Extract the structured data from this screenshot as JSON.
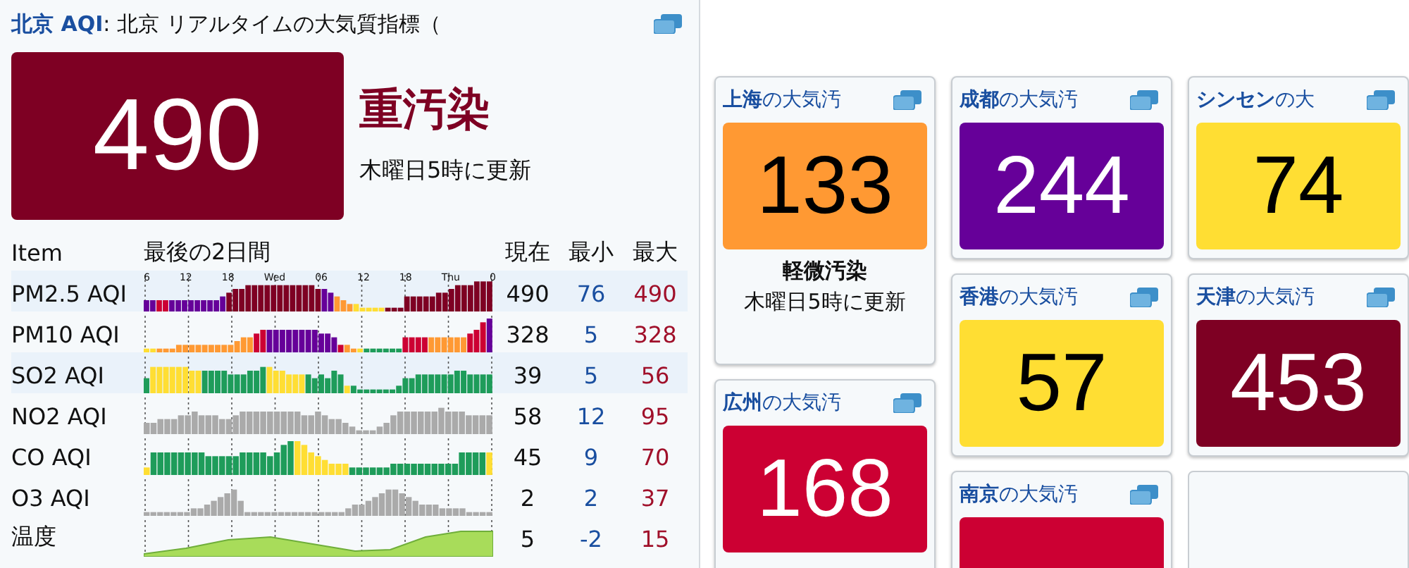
{
  "main": {
    "city": "北京 AQI",
    "title_suffix": ": 北京 リアルタイムの大気質指標（",
    "aqi": "490",
    "color": "#7e0023",
    "level_label": "重汚染",
    "updated": "木曜日5時に更新",
    "table": {
      "columns": [
        "Item",
        "最後の2日間",
        "現在",
        "最小",
        "最大"
      ],
      "time_ticks": [
        "6",
        "12",
        "18",
        "Wed",
        "06",
        "12",
        "18",
        "Thu",
        "0"
      ],
      "rows": [
        {
          "name": "PM2.5 AQI",
          "current": "490",
          "min": "76",
          "max": "490"
        },
        {
          "name": "PM10 AQI",
          "current": "328",
          "min": "5",
          "max": "328"
        },
        {
          "name": "SO2 AQI",
          "current": "39",
          "min": "5",
          "max": "56"
        },
        {
          "name": "NO2 AQI",
          "current": "58",
          "min": "12",
          "max": "95"
        },
        {
          "name": "CO AQI",
          "current": "45",
          "min": "9",
          "max": "70"
        },
        {
          "name": "O3 AQI",
          "current": "2",
          "min": "2",
          "max": "37"
        },
        {
          "name": "温度",
          "current": "5",
          "min": "-2",
          "max": "15"
        }
      ]
    }
  },
  "city_columns": [
    [
      {
        "kind": "detailed",
        "city": "上海",
        "suffix": "の大気汚",
        "aqi": "133",
        "color": "#ff9933",
        "level_label": "軽微汚染",
        "updated": "木曜日5時に更新"
      },
      {
        "kind": "detailed",
        "city": "広州",
        "suffix": "の大気汚",
        "aqi": "168",
        "color": "#cc0033"
      }
    ],
    [
      {
        "kind": "compact",
        "city": "成都",
        "suffix": "の大気汚",
        "aqi": "244",
        "color": "#660099"
      },
      {
        "kind": "compact",
        "city": "香港",
        "suffix": "の大気汚",
        "aqi": "57",
        "color": "#ffde33"
      },
      {
        "kind": "compact",
        "city": "南京",
        "suffix": "の大気汚",
        "color": "#cc0033"
      }
    ],
    [
      {
        "kind": "compact",
        "city": "シンセン",
        "suffix": "の大",
        "aqi": "74",
        "color": "#ffde33"
      },
      {
        "kind": "compact",
        "city": "天津",
        "suffix": "の大気汚",
        "aqi": "453",
        "color": "#7e0023"
      },
      {
        "kind": "empty"
      }
    ]
  ]
}
